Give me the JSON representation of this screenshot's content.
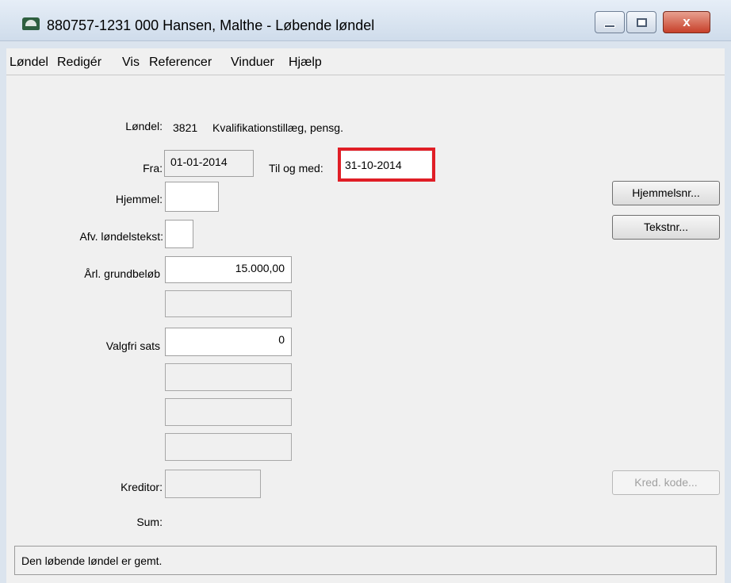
{
  "window": {
    "title": "880757-1231 000 Hansen, Malthe - Løbende løndel",
    "close_glyph": "x"
  },
  "menu": {
    "items": [
      "Løndel",
      "Redigér",
      "Vis",
      "Referencer",
      "Vinduer",
      "Hjælp"
    ]
  },
  "form": {
    "loendel_label": "Løndel:",
    "loendel_code": "3821",
    "loendel_text": "Kvalifikationstillæg, pensg.",
    "fra_label": "Fra:",
    "fra_value": "01-01-2014",
    "til_label": "Til og med:",
    "til_value": "31-10-2014",
    "hjemmel_label": "Hjemmel:",
    "hjemmel_value": "",
    "afv_label": "Afv. løndelstekst:",
    "afv_value": "",
    "aarl_label": "Årl. grundbeløb",
    "aarl_value": "15.000,00",
    "valgfri_label": "Valgfri sats",
    "valgfri_value": "0",
    "kreditor_label": "Kreditor:",
    "kreditor_value": "",
    "sum_label": "Sum:"
  },
  "buttons": {
    "hjemmelsnr": "Hjemmelsnr...",
    "tekstnr": "Tekstnr...",
    "kred_kode": "Kred. kode..."
  },
  "status": {
    "message": "Den løbende løndel er gemt."
  },
  "colors": {
    "highlight": "#e01e26"
  }
}
